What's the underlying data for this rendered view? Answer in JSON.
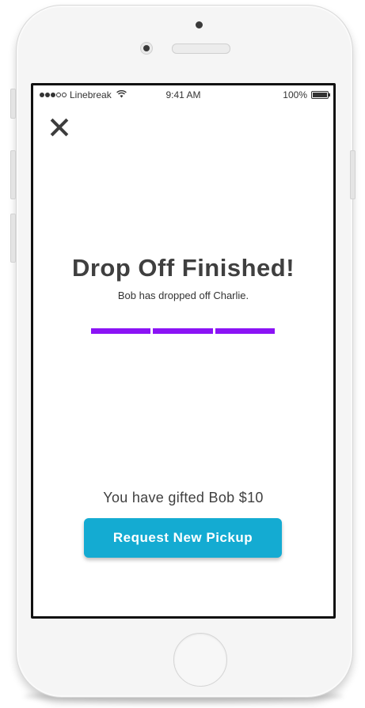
{
  "status_bar": {
    "carrier": "Linebreak",
    "time": "9:41 AM",
    "battery": "100%"
  },
  "screen": {
    "title": "Drop Off Finished!",
    "subtitle": "Bob has dropped off Charlie.",
    "progress": {
      "segments": 3,
      "completed": 3,
      "color": "#8b13f5"
    },
    "gift_text": "You have gifted Bob $10",
    "primary_button_label": "Request New Pickup",
    "primary_button_color": "#14abd2"
  },
  "icons": {
    "close": "close-icon",
    "wifi": "wifi-icon",
    "battery": "battery-icon",
    "signal": "signal-dots-icon"
  }
}
